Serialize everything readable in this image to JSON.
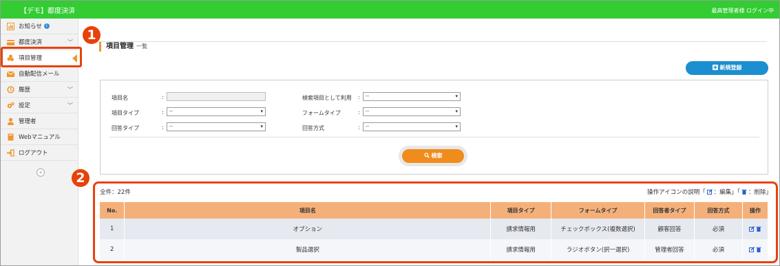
{
  "header": {
    "title": "【デモ】都度決済",
    "status": "最高管理者様 ログイン中"
  },
  "sidebar": {
    "items": [
      {
        "label": "お知らせ",
        "icon": "bar-chart-icon"
      },
      {
        "label": "都度決済",
        "icon": "card-icon"
      },
      {
        "label": "項目管理",
        "icon": "items-icon"
      },
      {
        "label": "自動配信メール",
        "icon": "mail-icon"
      },
      {
        "label": "履歴",
        "icon": "history-icon"
      },
      {
        "label": "設定",
        "icon": "gear-icon"
      },
      {
        "label": "管理者",
        "icon": "user-icon"
      },
      {
        "label": "Webマニュアル",
        "icon": "book-icon"
      },
      {
        "label": "ログアウト",
        "icon": "logout-icon"
      }
    ],
    "collapse_label": "«"
  },
  "annotations": {
    "badge1": "1",
    "badge2": "2"
  },
  "page": {
    "title": "項目管理",
    "subtitle": "一覧",
    "new_button": "新規登録"
  },
  "search": {
    "item_name_label": "項目名",
    "item_name_value": "",
    "use_as_search_label": "検索項目として利用",
    "use_as_search_value": "--",
    "item_type_label": "項目タイプ",
    "item_type_value": "--",
    "form_type_label": "フォームタイプ",
    "form_type_value": "--",
    "answer_type_label": "回答タイプ",
    "answer_type_value": "--",
    "answer_method_label": "回答方式",
    "answer_method_value": "--",
    "colon": ":",
    "search_button": "検索"
  },
  "results": {
    "count_label": "全件：22件",
    "legend_prefix": "操作アイコンの説明「",
    "legend_edit": "：編集」「",
    "legend_delete": "：削除」",
    "columns": [
      "No.",
      "項目名",
      "項目タイプ",
      "フォームタイプ",
      "回答者タイプ",
      "回答方式",
      "操作"
    ],
    "rows": [
      {
        "no": "1",
        "name": "オプション",
        "item_type": "請求情報用",
        "form_type": "チェックボックス(複数選択)",
        "respondent": "顧客回答",
        "method": "必須"
      },
      {
        "no": "2",
        "name": "製品選択",
        "item_type": "請求情報用",
        "form_type": "ラジオボタン(択一選択)",
        "respondent": "管理者回答",
        "method": "必須"
      }
    ]
  },
  "colors": {
    "header_green": "#33cc33",
    "accent_orange": "#f0962e",
    "highlight_red": "#e8410a",
    "button_blue": "#1b8fcf",
    "table_header": "#f5b07a"
  }
}
